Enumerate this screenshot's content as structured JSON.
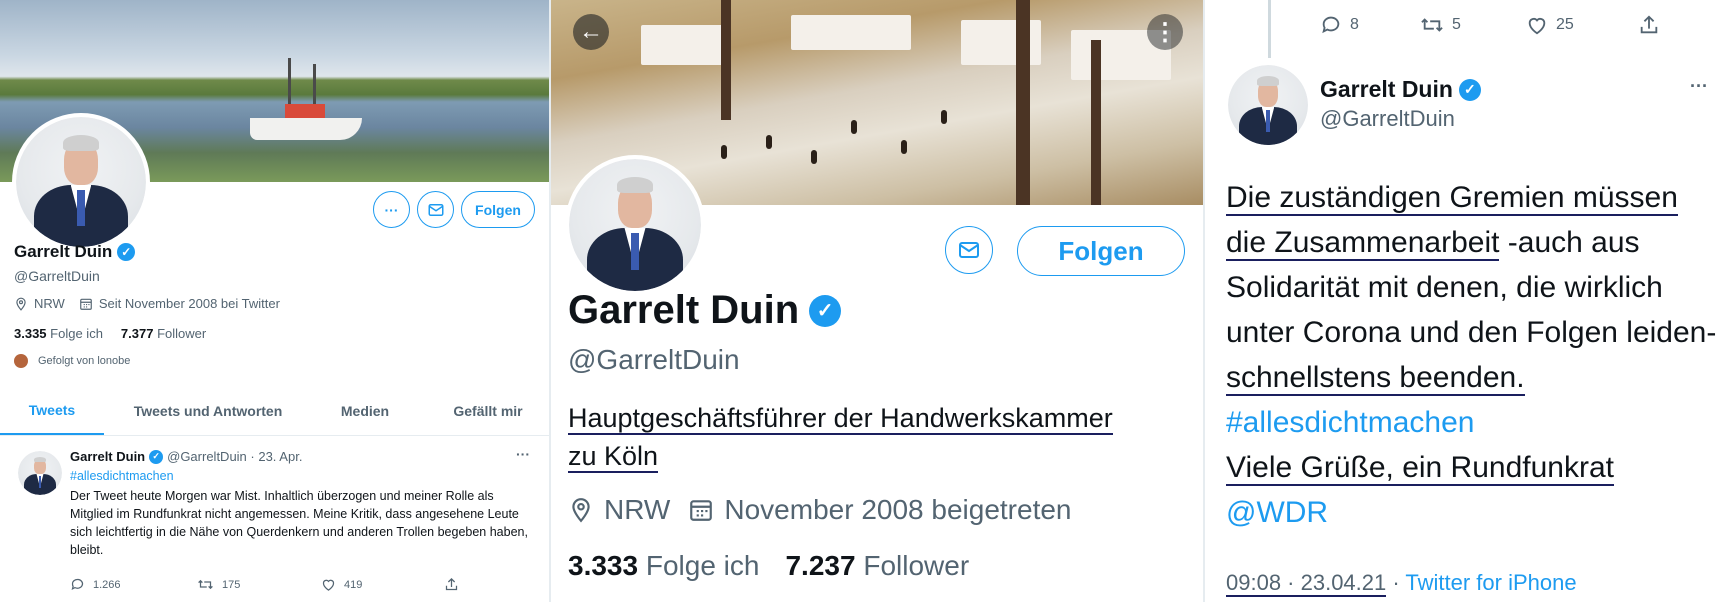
{
  "panel_left": {
    "name": "Garrelt Duin",
    "handle": "@GarreltDuin",
    "location": "NRW",
    "joined": "Seit November 2008 bei Twitter",
    "following_count": "3.335",
    "following_label": "Folge ich",
    "followers_count": "7.377",
    "followers_label": "Follower",
    "followed_by": "Gefolgt von lonobe",
    "more_label": "···",
    "follow_label": "Folgen",
    "tabs": [
      {
        "label": "Tweets"
      },
      {
        "label": "Tweets und Antworten"
      },
      {
        "label": "Medien"
      },
      {
        "label": "Gefällt mir"
      }
    ],
    "tweet": {
      "author": "Garrelt Duin",
      "handle_date": "@GarreltDuin · 23. Apr.",
      "more": "···",
      "hashtag": "#allesdichtmachen",
      "text": "Der Tweet heute Morgen war Mist. Inhaltlich überzogen und meiner Rolle als Mitglied im Rundfunkrat nicht angemessen. Meine Kritik, dass angesehene Leute sich leichtfertig in die Nähe von Querdenkern und anderen Trollen begeben haben, bleibt.",
      "replies": "1.266",
      "retweets": "175",
      "likes": "419"
    }
  },
  "panel_middle": {
    "name": "Garrelt Duin",
    "handle": "@GarreltDuin",
    "bio_line1": "Hauptgeschäftsführer der Handwerkskammer",
    "bio_line2": "zu Köln",
    "location": "NRW",
    "joined": "November 2008 beigetreten",
    "following_count": "3.333",
    "following_label": "Folge ich",
    "followers_count": "7.237",
    "followers_label": "Follower",
    "follow_label": "Folgen",
    "back_icon": "←",
    "more_icon": "⋮"
  },
  "panel_right": {
    "top_replies": "8",
    "top_retweets": "5",
    "top_likes": "25",
    "name": "Garrelt Duin",
    "handle": "@GarreltDuin",
    "more": "···",
    "text_parts": {
      "p1": "Die zuständigen Gremien müssen",
      "p2": "die Zusammenarbeit",
      "p3": " -auch aus Solidarität mit denen, die wirklich unter Corona und den Folgen leiden- ",
      "p4": "schnellstens beenden.",
      "hashtag": "#allesdichtmachen",
      "p5": "Viele Grüße, ein Rundfunkrat",
      "mention": "@WDR"
    },
    "timestamp": "09:08 · 23.04.21",
    "source_sep": " · ",
    "source": "Twitter for iPhone"
  },
  "colors": {
    "accent": "#1d9bf0",
    "text": "#0f1419",
    "muted": "#536471",
    "underline": "#1a1f5e"
  }
}
